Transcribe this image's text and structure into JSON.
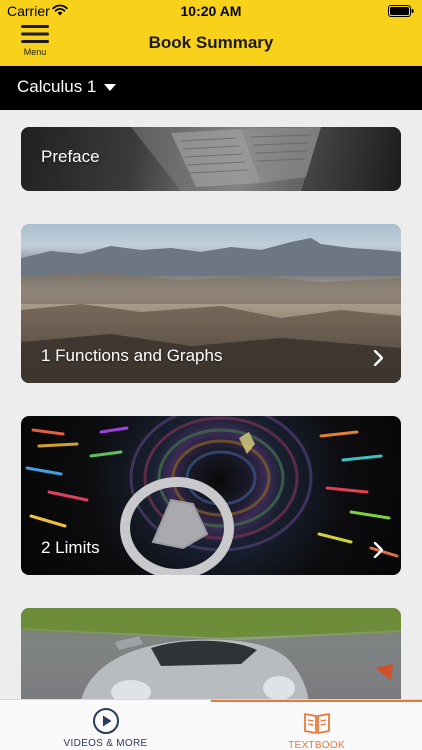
{
  "status_bar": {
    "carrier": "Carrier",
    "time": "10:20 AM",
    "wifi_icon": "wifi-icon",
    "battery_icon": "battery-icon"
  },
  "header": {
    "menu_label": "Menu",
    "menu_icon": "hamburger-menu-icon",
    "title": "Book Summary",
    "color": "#f8d11b"
  },
  "book_selector": {
    "value": "Calculus 1",
    "icon": "caret-down-icon"
  },
  "chapters": [
    {
      "label": "Preface",
      "image": "open-book-photo",
      "has_chevron": false
    },
    {
      "label": "1 Functions and Graphs",
      "image": "desert-mountains-photo",
      "has_chevron": true
    },
    {
      "label": "2 Limits",
      "image": "space-wormhole-illustration",
      "has_chevron": true
    },
    {
      "label": "",
      "image": "silver-sports-car-photo",
      "has_chevron": false
    }
  ],
  "tabs": [
    {
      "label": "VIDEOS & MORE",
      "icon": "play-circle-icon",
      "active": false
    },
    {
      "label": "TEXTBOOK",
      "icon": "open-book-icon",
      "active": true
    }
  ],
  "colors": {
    "accent": "#e8793b",
    "header_yellow": "#f8d11b",
    "book_bar": "#000000",
    "background": "#ededed"
  }
}
